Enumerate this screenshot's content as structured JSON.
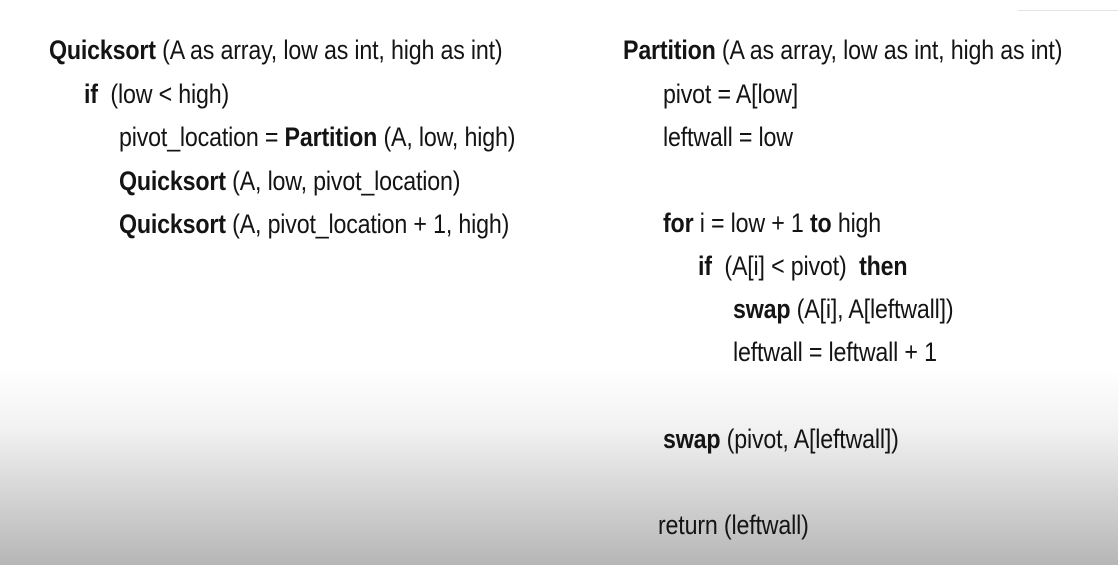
{
  "quicksort": {
    "sig_kw": "Quicksort",
    "sig_rest": " (A as array, low as int, high as int)",
    "if_kw": "if",
    "if_rest": "  (low < high)",
    "pivot_pre": "pivot_location = ",
    "pivot_kw": "Partition",
    "pivot_rest": " (A, low, high)",
    "call1_kw": "Quicksort",
    "call1_rest": " (A, low, pivot_location)",
    "call2_kw": "Quicksort",
    "call2_rest": " (A, pivot_location + 1, high)"
  },
  "partition": {
    "sig_kw": "Partition",
    "sig_rest": " (A as array, low as int, high as int)",
    "pivot_line": "pivot = A[low]",
    "leftwall_line": "leftwall = low",
    "for_kw": "for",
    "for_mid": " i = low + 1 ",
    "to_kw": "to",
    "for_rest": " high",
    "if_kw": "if",
    "if_cond": "  (A[i] < pivot)  ",
    "then_kw": "then",
    "swap1_kw": "swap",
    "swap1_rest": " (A[i], A[leftwall])",
    "incr_line": "leftwall = leftwall + 1",
    "swap2_kw": "swap",
    "swap2_rest": " (pivot, A[leftwall])",
    "return_line": "return (leftwall)"
  }
}
